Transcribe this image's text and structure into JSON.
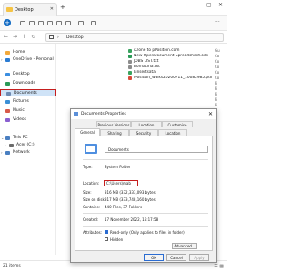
{
  "window": {
    "tab_title": "Desktop",
    "tab_close": "✕",
    "new_tab": "+",
    "minimize": "–",
    "maximize": "▢",
    "close": "✕"
  },
  "address": {
    "crumb_sep": "›",
    "crumb": "Desktop"
  },
  "sidebar": {
    "items": [
      {
        "label": "Home",
        "icon": "home-icon",
        "color": "#f2a93b"
      },
      {
        "label": "OneDrive - Personal",
        "icon": "cloud-icon",
        "color": "#2b7cd3"
      },
      {
        "label": "Desktop",
        "icon": "desktop-icon",
        "color": "#3b8ee0"
      },
      {
        "label": "Downloads",
        "icon": "download-icon",
        "color": "#2b9a57"
      },
      {
        "label": "Documents",
        "icon": "document-icon",
        "color": "#6e8bb3"
      },
      {
        "label": "Pictures",
        "icon": "pictures-icon",
        "color": "#3a8fd6"
      },
      {
        "label": "Music",
        "icon": "music-icon",
        "color": "#d85a4a"
      },
      {
        "label": "Videos",
        "icon": "videos-icon",
        "color": "#8a5fd0"
      },
      {
        "label": "This PC",
        "icon": "pc-icon",
        "color": "#4a7fc1"
      },
      {
        "label": "Acer (C:)",
        "icon": "drive-icon",
        "color": "#6b6b6b"
      },
      {
        "label": "Network",
        "icon": "network-icon",
        "color": "#4a7fc1"
      }
    ]
  },
  "files": [
    {
      "name": "iClone to pPosition.com",
      "color": "#3aa35f"
    },
    {
      "name": "New OpenDocument Spreadsheet.ods",
      "color": "#2b9a57"
    },
    {
      "name": "JOBS LIST.txt",
      "color": "#8c8c8c"
    },
    {
      "name": "Bornacina.txt",
      "color": "#8c8c8c"
    },
    {
      "name": "Linsertsata",
      "color": "#3aa35f"
    },
    {
      "name": "iPosition_walks20200711_10082985.pdf",
      "color": "#d84a3a"
    }
  ],
  "right_column": [
    "Gu",
    "Co",
    "Co",
    "Co",
    "Co",
    "Co",
    "Fi",
    "Fi",
    "Fi",
    "Fi",
    "Fi",
    "Fi",
    "Fi",
    "Fi",
    "Fi",
    "Fi",
    "Fi",
    "Fi",
    "Fi",
    "Fi",
    "Fi",
    "Fi",
    "Fi",
    "Fi"
  ],
  "dialog": {
    "title": "Documents Properties",
    "close": "✕",
    "tabs_top": [
      "Previous Versions",
      "Location",
      "Customise"
    ],
    "tabs_bottom": [
      "General",
      "Sharing",
      "Security",
      "Location"
    ],
    "name_value": "Documents",
    "type_label": "Type:",
    "type_value": "System Folder",
    "location_label": "Location:",
    "location_value": "C:\\Users\\mab",
    "size_label": "Size:",
    "size_value": "316 MB (332,333,093 bytes)",
    "size_on_disk_label": "Size on disk:",
    "size_on_disk_value": "317 MB (333,748,160 bytes)",
    "contains_label": "Contains:",
    "contains_value": "440 Files, 37 Folders",
    "created_label": "Created:",
    "created_value": "17 November 2022, 16:17:58",
    "attributes_label": "Attributes:",
    "readonly_label": "Read-only (Only applies to files in folder)",
    "hidden_label": "Hidden",
    "advanced_label": "Advanced...",
    "ok_label": "OK",
    "cancel_label": "Cancel",
    "apply_label": "Apply"
  },
  "status": {
    "text": "21 items",
    "views": "☰ ▦"
  }
}
